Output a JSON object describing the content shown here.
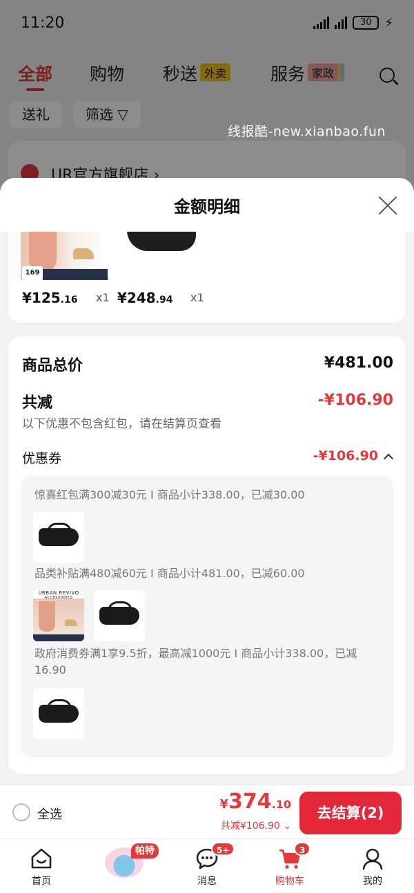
{
  "status_bar": {
    "time": "11:20",
    "battery": "30"
  },
  "top_tabs": [
    {
      "label": "全部",
      "active": true
    },
    {
      "label": "购物"
    },
    {
      "label": "秒送",
      "tag": "外卖"
    },
    {
      "label": "服务",
      "tag": "家政"
    }
  ],
  "filters": {
    "gift": "送礼",
    "filter": "筛选"
  },
  "watermark": "线报酷-new.xianbao.fun",
  "shop": {
    "name": "UR官方旗舰店 ›"
  },
  "sheet": {
    "title": "金额明细",
    "products": [
      {
        "price_int": "¥125",
        "price_dec": ".16",
        "qty": "x1",
        "thumb_price": "169"
      },
      {
        "price_int": "¥248",
        "price_dec": ".94",
        "qty": "x1"
      }
    ],
    "summary": {
      "total_label": "商品总价",
      "total_value": "¥481.00",
      "discount_label": "共减",
      "discount_value": "-¥106.90",
      "note": "以下优惠不包含红包，请在结算页查看",
      "coupon_label": "优惠券",
      "coupon_value": "-¥106.90"
    },
    "coupons": [
      {
        "text": "惊喜红包满300减30元 I 商品小计338.00，已减30.00"
      },
      {
        "text": "品类补贴满480减60元 I 商品小计481.00，已减60.00",
        "brand": "URBAN REVIVO",
        "brand_sub": "ACCESSORIES"
      },
      {
        "text": "政府消费券满1享9.5折，最高减1000元 I 商品小计338.00，已减16.90"
      }
    ]
  },
  "checkout": {
    "select_all": "全选",
    "total_currency": "¥",
    "total_int": "374",
    "total_dec": ".10",
    "saved": "共减¥106.90",
    "button": "去结算(2)"
  },
  "tab_bar": {
    "items": [
      {
        "label": "首页",
        "icon": "home-icon"
      },
      {
        "label": "",
        "icon": "promo-image",
        "badge": "帕特"
      },
      {
        "label": "消息",
        "icon": "message-icon",
        "badge": "5+"
      },
      {
        "label": "购物车",
        "icon": "cart-icon",
        "badge": "3",
        "active": true
      },
      {
        "label": "我的",
        "icon": "profile-icon"
      }
    ]
  },
  "colors": {
    "accent": "#e4393c",
    "button": "#e4283a",
    "tag_yellow": "#f5c31b"
  }
}
